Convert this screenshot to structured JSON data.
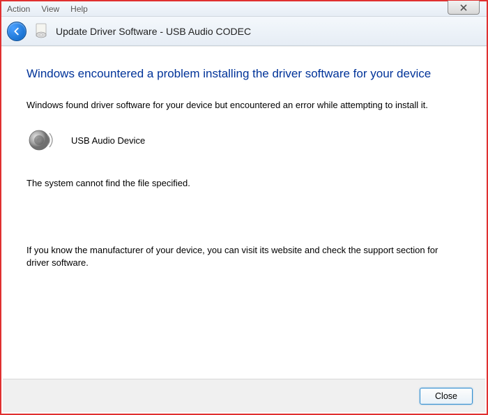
{
  "menubar": {
    "items": [
      "Action",
      "View",
      "Help"
    ]
  },
  "header": {
    "title": "Update Driver Software - USB Audio CODEC "
  },
  "main": {
    "heading": "Windows encountered a problem installing the driver software for your device",
    "found_text": "Windows found driver software for your device but encountered an error while attempting to install it.",
    "device_name": "USB Audio Device",
    "error_text": "The system cannot find the file specified.",
    "hint_text": "If you know the manufacturer of your device, you can visit its website and check the support section for driver software."
  },
  "footer": {
    "close_label": "Close"
  }
}
